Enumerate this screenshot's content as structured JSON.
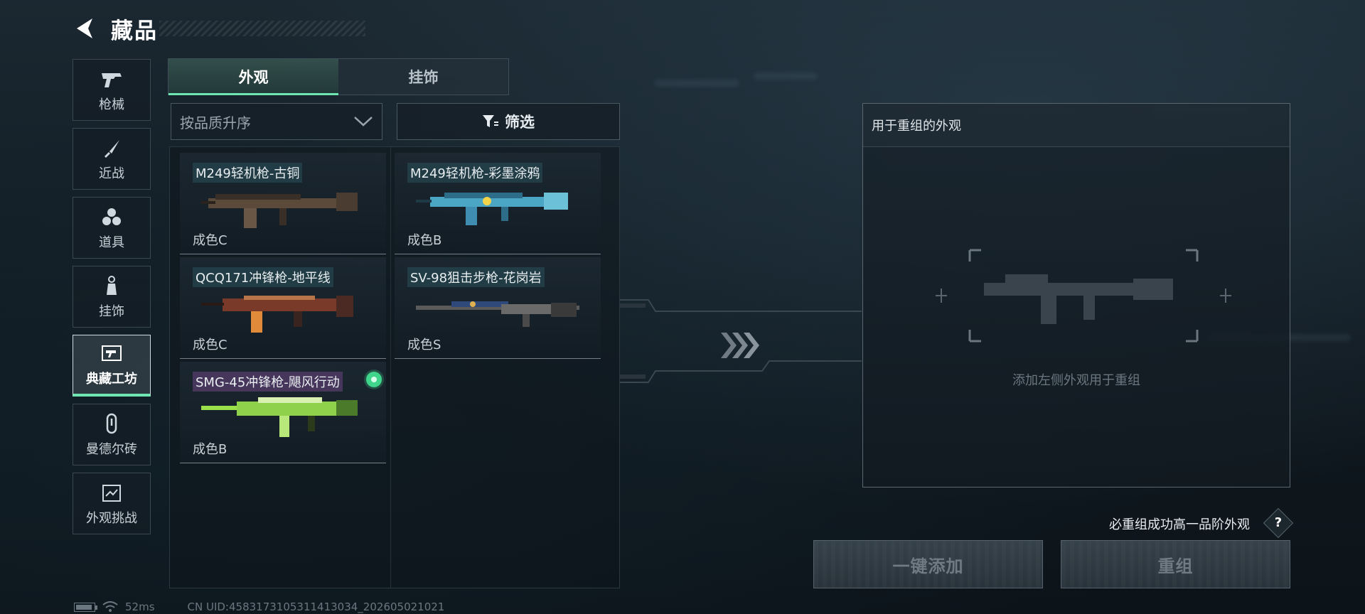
{
  "header": {
    "title": "藏品",
    "back_icon": "chevron-left-icon"
  },
  "sidebar": {
    "items": [
      {
        "label": "枪械",
        "icon": "pistol-icon",
        "active": false
      },
      {
        "label": "近战",
        "icon": "knife-icon",
        "active": false
      },
      {
        "label": "道具",
        "icon": "hex-cluster-icon",
        "active": false
      },
      {
        "label": "挂饰",
        "icon": "charm-icon",
        "active": false
      },
      {
        "label": "典藏工坊",
        "icon": "workshop-icon",
        "active": true
      },
      {
        "label": "曼德尔砖",
        "icon": "brick-icon",
        "active": false
      },
      {
        "label": "外观挑战",
        "icon": "challenge-icon",
        "active": false
      }
    ]
  },
  "tabs": [
    {
      "label": "外观",
      "active": true
    },
    {
      "label": "挂饰",
      "active": false
    }
  ],
  "sort": {
    "value": "按品质升序"
  },
  "filter": {
    "label": "筛选"
  },
  "cards": [
    {
      "name": "M249轻机枪-古铜",
      "grade": "成色C",
      "selected": false,
      "name_style": "teal"
    },
    {
      "name": "M249轻机枪-彩墨涂鸦",
      "grade": "成色B",
      "selected": false,
      "name_style": "teal"
    },
    {
      "name": "QCQ171冲锋枪-地平线",
      "grade": "成色C",
      "selected": false,
      "name_style": "teal"
    },
    {
      "name": "SV-98狙击步枪-花岗岩",
      "grade": "成色S",
      "selected": false,
      "name_style": "teal"
    },
    {
      "name": "SMG-45冲锋枪-飓风行动",
      "grade": "成色B",
      "selected": true,
      "name_style": "purple"
    }
  ],
  "recombine": {
    "title": "用于重组的外观",
    "hint": "添加左侧外观用于重组",
    "rule_text": "必重组成功高一品阶外观",
    "help_label": "?",
    "add_all_label": "一键添加",
    "recombine_label": "重组"
  },
  "footer": {
    "ping": "52ms",
    "uid": "CN UID:4583173105311413034_202605021021"
  },
  "colors": {
    "accent": "#6ee6b2",
    "selected_dot": "#3fd58b",
    "background": "#111a21"
  }
}
